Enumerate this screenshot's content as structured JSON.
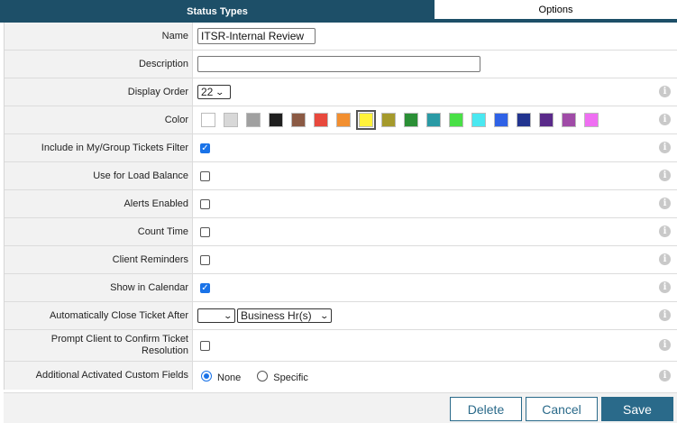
{
  "tabs": {
    "status_types": "Status Types",
    "options": "Options"
  },
  "fields": {
    "name": {
      "label": "Name",
      "value": "ITSR-Internal Review"
    },
    "description": {
      "label": "Description",
      "value": ""
    },
    "display_order": {
      "label": "Display Order",
      "value": "22"
    },
    "color": {
      "label": "Color",
      "swatches": [
        "#ffffff",
        "#d8d8d8",
        "#a0a0a0",
        "#1f1f1f",
        "#8b5a44",
        "#e8493d",
        "#f28f30",
        "#fff23a",
        "#a59a2c",
        "#2b8f36",
        "#2a9aa5",
        "#49e046",
        "#4ae8f1",
        "#2f62e6",
        "#22348f",
        "#5a2a8a",
        "#a04ba7",
        "#ef6ef2"
      ],
      "selected_index": 7
    },
    "include_filter": {
      "label": "Include in My/Group Tickets Filter",
      "checked": true
    },
    "load_balance": {
      "label": "Use for Load Balance",
      "checked": false
    },
    "alerts_enabled": {
      "label": "Alerts Enabled",
      "checked": false
    },
    "count_time": {
      "label": "Count Time",
      "checked": false
    },
    "client_reminders": {
      "label": "Client Reminders",
      "checked": false
    },
    "show_calendar": {
      "label": "Show in Calendar",
      "checked": true
    },
    "auto_close": {
      "label": "Automatically Close Ticket After",
      "amount": "",
      "unit": "Business Hr(s)"
    },
    "prompt_client": {
      "label": "Prompt Client to Confirm Ticket Resolution",
      "checked": false
    },
    "custom_fields": {
      "label": "Additional Activated Custom Fields",
      "none_label": "None",
      "specific_label": "Specific",
      "selected": "None"
    }
  },
  "info_icon_glyph": "i",
  "buttons": {
    "delete": "Delete",
    "cancel": "Cancel",
    "save": "Save"
  }
}
